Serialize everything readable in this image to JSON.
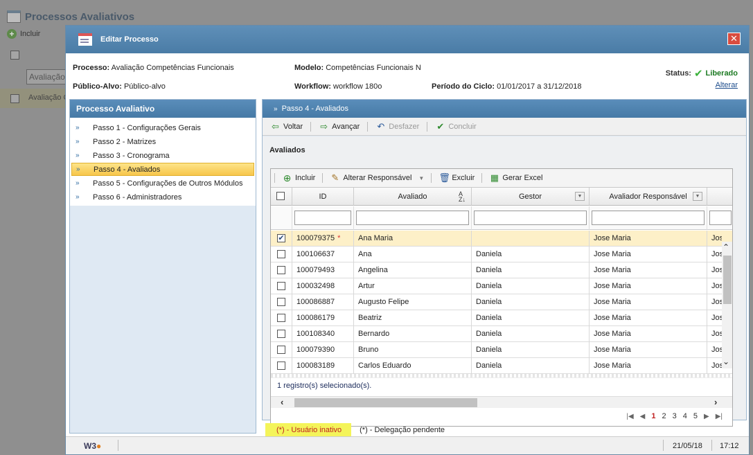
{
  "background": {
    "page_title": "Processos Avaliativos",
    "toolbar_include": "Incluir",
    "filter_placeholder": "Avaliação",
    "row_text": "Avaliação C"
  },
  "modal": {
    "title": "Editar Processo",
    "close_glyph": "✕",
    "info": {
      "processo_label": "Processo:",
      "processo_value": "Avaliação Competências Funcionais",
      "modelo_label": "Modelo:",
      "modelo_value": "Competências Funcionais N",
      "publico_label": "Público-Alvo:",
      "publico_value": "Público-alvo",
      "workflow_label": "Workflow:",
      "workflow_value": "workflow 180o",
      "periodo_label": "Período do Ciclo:",
      "periodo_value": "01/01/2017 a 31/12/2018",
      "status_label": "Status:",
      "status_value": "Liberado",
      "alterar": "Alterar"
    },
    "left_panel": {
      "title": "Processo Avaliativo",
      "steps": [
        {
          "label": "Passo 1 - Configurações Gerais"
        },
        {
          "label": "Passo 2 - Matrizes"
        },
        {
          "label": "Passo 3 - Cronograma"
        },
        {
          "label": "Passo 4 - Avaliados"
        },
        {
          "label": "Passo 5 - Configurações de Outros Módulos"
        },
        {
          "label": "Passo 6 - Administradores"
        }
      ],
      "active_index": 3
    },
    "right_panel": {
      "title": "Passo 4 - Avaliados",
      "toolbar": {
        "voltar": "Voltar",
        "avancar": "Avançar",
        "desfazer": "Desfazer",
        "concluir": "Concluir"
      },
      "section_title": "Avaliados",
      "grid_toolbar": {
        "incluir": "Incluir",
        "alterar_responsavel": "Alterar Responsável",
        "excluir": "Excluir",
        "gerar_excel": "Gerar Excel"
      },
      "columns": {
        "id": "ID",
        "avaliado": "Avaliado",
        "gestor": "Gestor",
        "avaliador": "Avaliador Responsável"
      },
      "rows": [
        {
          "id": "100079375",
          "star": "*",
          "avaliado": "Ana Maria",
          "gestor": "",
          "avaliador": "Jose Maria",
          "extra": "Jos",
          "checked": true
        },
        {
          "id": "100106637",
          "star": "",
          "avaliado": "Ana",
          "gestor": "Daniela",
          "avaliador": "Jose Maria",
          "extra": "Jos",
          "checked": false
        },
        {
          "id": "100079493",
          "star": "",
          "avaliado": "Angelina",
          "gestor": "Daniela",
          "avaliador": "Jose Maria",
          "extra": "Jos",
          "checked": false
        },
        {
          "id": "100032498",
          "star": "",
          "avaliado": "Artur",
          "gestor": "Daniela",
          "avaliador": "Jose Maria",
          "extra": "Jos",
          "checked": false
        },
        {
          "id": "100086887",
          "star": "",
          "avaliado": "Augusto Felipe",
          "gestor": "Daniela",
          "avaliador": "Jose Maria",
          "extra": "Jos",
          "checked": false
        },
        {
          "id": "100086179",
          "star": "",
          "avaliado": "Beatriz",
          "gestor": "Daniela",
          "avaliador": "Jose Maria",
          "extra": "Jos",
          "checked": false
        },
        {
          "id": "100108340",
          "star": "",
          "avaliado": "Bernardo",
          "gestor": "Daniela",
          "avaliador": "Jose Maria",
          "extra": "Jos",
          "checked": false
        },
        {
          "id": "100079390",
          "star": "",
          "avaliado": "Bruno",
          "gestor": "Daniela",
          "avaliador": "Jose Maria",
          "extra": "Jos",
          "checked": false
        },
        {
          "id": "100083189",
          "star": "",
          "avaliado": "Carlos Eduardo",
          "gestor": "Daniela",
          "avaliador": "Jose Maria",
          "extra": "Jos",
          "checked": false
        }
      ],
      "selected_count": "1 registro(s) selecionado(s).",
      "pager": [
        "1",
        "2",
        "3",
        "4",
        "5"
      ],
      "current_page": "1"
    },
    "legend": {
      "inactive": "(*) - Usuário inativo",
      "pending": "(*) - Delegação pendente"
    },
    "footer": {
      "logo": "W3",
      "date": "21/05/18",
      "time": "17:12"
    }
  },
  "icons": {
    "step_arrow": "»",
    "check": "✔",
    "plus": "+"
  },
  "colors": {
    "header_blue": "#4a7ca6",
    "status_green": "#1c7a22",
    "active_step": "#f7c64a",
    "selected_row": "#fdf0c8",
    "inactive_legend_bg": "#f4f45a",
    "inactive_legend_text": "#c02020"
  }
}
